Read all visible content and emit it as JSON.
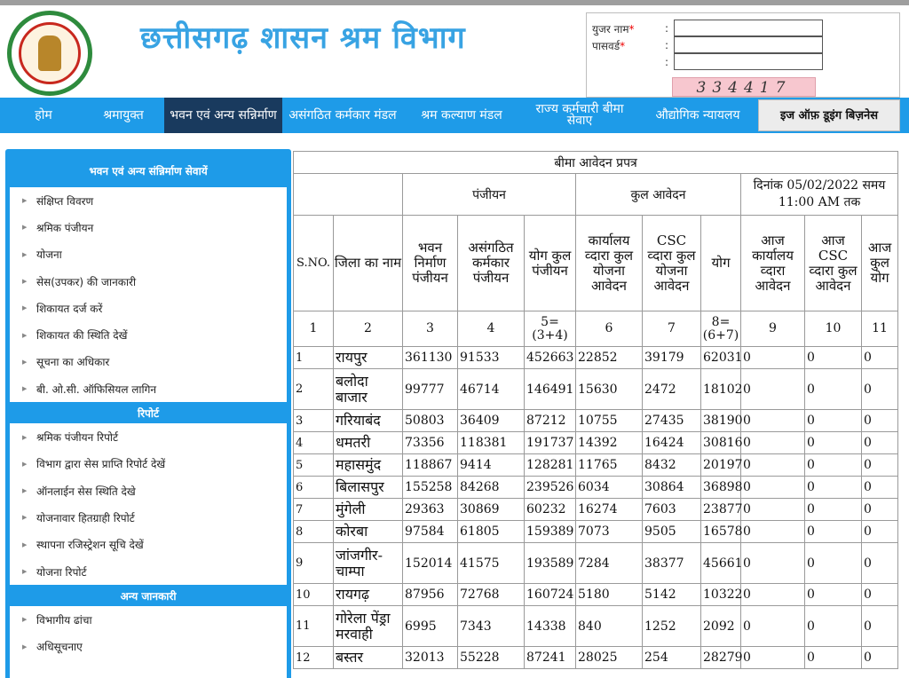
{
  "header": {
    "title": "छत्तीसगढ़ शासन श्रम विभाग",
    "emblem_text": "छत्तीसगढ़ शासन"
  },
  "login": {
    "username_label": "युजर नाम",
    "password_label": "पासवर्ड",
    "required_mark": "*",
    "colon": ":",
    "captcha": "334417"
  },
  "nav": {
    "items": [
      {
        "label": "होम"
      },
      {
        "label": "श्रमायुक्त"
      },
      {
        "label": "भवन एवं अन्य सन्निर्माण"
      },
      {
        "label": "असंगठित कर्मकार मंडल"
      },
      {
        "label": "श्रम कल्याण मंडल"
      },
      {
        "label": "राज्य कर्मचारी बीमा सेवाए"
      },
      {
        "label": "औद्योगिक न्यायलय"
      },
      {
        "label": "इज ऑफ़ डूइंग बिज़नेस"
      }
    ]
  },
  "sidebar": {
    "section1_title": "भवन एवं अन्य संन्निर्माण सेवायें",
    "section1_items": [
      {
        "label": "संक्षिप्त विवरण"
      },
      {
        "label": "श्रमिक पंजीयन"
      },
      {
        "label": "योजना"
      },
      {
        "label": "सेस(उपकर) की जानकारी"
      },
      {
        "label": "शिकायत दर्ज करें"
      },
      {
        "label": "शिकायत की स्थिति देखें"
      },
      {
        "label": "सूचना का अधिकार"
      },
      {
        "label": "बी. ओ.सी. ऑफिसियल लागिन"
      }
    ],
    "section2_title": "रिपोर्ट",
    "section2_items": [
      {
        "label": "श्रमिक पंजीयन रिपोर्ट"
      },
      {
        "label": "विभाग द्वारा सेस प्राप्ति रिपोर्ट देखें"
      },
      {
        "label": "ऑनलाईन सेस स्थिति देखे"
      },
      {
        "label": "योजनावार हितग्राही रिपोर्ट"
      },
      {
        "label": "स्थापना रजिस्ट्रेशन सूचि देखें"
      },
      {
        "label": "योजना रिपोर्ट"
      }
    ],
    "section3_title": "अन्य जानकारी",
    "section3_items": [
      {
        "label": "विभागीय ढांचा"
      },
      {
        "label": "अधिसूचनाए"
      }
    ]
  },
  "table": {
    "caption": "बीमा आवेदन प्रपत्र",
    "group_registration": "पंजीयन",
    "group_total": "कुल आवेदन",
    "group_date": "दिनांक 05/02/2022 समय 11:00 AM तक",
    "headers": [
      "S.NO.",
      "जिला का नाम",
      "भवन निर्माण पंजीयन",
      "असंगठित कर्मकार पंजीयन",
      "योग कुल पंजीयन",
      "कार्यालय व्दारा कुल योजना आवेदन",
      "CSC व्दारा कुल योजना आवेदन",
      "योग",
      "आज कार्यालय व्दारा आवेदन",
      "आज CSC व्दारा कुल आवेदन",
      "आज कुल योग"
    ],
    "col_numbers": [
      "1",
      "2",
      "3",
      "4",
      "5=(3+4)",
      "6",
      "7",
      "8=(6+7)",
      "9",
      "10",
      "11"
    ],
    "rows": [
      [
        "1",
        "रायपुर",
        "361130",
        "91533",
        "452663",
        "22852",
        "39179",
        "62031",
        "0",
        "0",
        "0"
      ],
      [
        "2",
        "बलोदा बाजार",
        "99777",
        "46714",
        "146491",
        "15630",
        "2472",
        "18102",
        "0",
        "0",
        "0"
      ],
      [
        "3",
        "गरियाबंद",
        "50803",
        "36409",
        "87212",
        "10755",
        "27435",
        "38190",
        "0",
        "0",
        "0"
      ],
      [
        "4",
        "धमतरी",
        "73356",
        "118381",
        "191737",
        "14392",
        "16424",
        "30816",
        "0",
        "0",
        "0"
      ],
      [
        "5",
        "महासमुंद",
        "118867",
        "9414",
        "128281",
        "11765",
        "8432",
        "20197",
        "0",
        "0",
        "0"
      ],
      [
        "6",
        "बिलासपुर",
        "155258",
        "84268",
        "239526",
        "6034",
        "30864",
        "36898",
        "0",
        "0",
        "0"
      ],
      [
        "7",
        "मुंगेली",
        "29363",
        "30869",
        "60232",
        "16274",
        "7603",
        "23877",
        "0",
        "0",
        "0"
      ],
      [
        "8",
        "कोरबा",
        "97584",
        "61805",
        "159389",
        "7073",
        "9505",
        "16578",
        "0",
        "0",
        "0"
      ],
      [
        "9",
        "जांजगीर-चाम्पा",
        "152014",
        "41575",
        "193589",
        "7284",
        "38377",
        "45661",
        "0",
        "0",
        "0"
      ],
      [
        "10",
        "रायगढ़",
        "87956",
        "72768",
        "160724",
        "5180",
        "5142",
        "10322",
        "0",
        "0",
        "0"
      ],
      [
        "11",
        "गोरेला पेंड्रा मरवाही",
        "6995",
        "7343",
        "14338",
        "840",
        "1252",
        "2092",
        "0",
        "0",
        "0"
      ],
      [
        "12",
        "बस्तर",
        "32013",
        "55228",
        "87241",
        "28025",
        "254",
        "28279",
        "0",
        "0",
        "0"
      ]
    ]
  }
}
